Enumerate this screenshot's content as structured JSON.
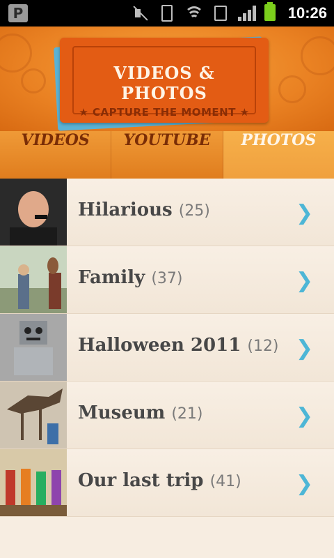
{
  "status_bar": {
    "app_icon_letter": "P",
    "time": "10:26",
    "icons": [
      "mute-icon",
      "vibrate-icon",
      "wifi-icon",
      "sim-icon",
      "signal-icon",
      "battery-icon"
    ]
  },
  "header": {
    "title": "VIDEOS & PHOTOS",
    "subtitle": "★ CAPTURE THE MOMENT ★"
  },
  "tabs": [
    {
      "label": "VIDEOS"
    },
    {
      "label": "YOUTUBE"
    },
    {
      "label": "PHOTOS",
      "active": true
    }
  ],
  "albums": [
    {
      "name": "Hilarious",
      "count": "(25)"
    },
    {
      "name": "Family",
      "count": "(37)"
    },
    {
      "name": "Halloween 2011",
      "count": "(12)"
    },
    {
      "name": "Museum",
      "count": "(21)"
    },
    {
      "name": "Our last trip",
      "count": "(41)"
    }
  ],
  "chevron": "❯",
  "colors": {
    "accent": "#e35c14",
    "chevron": "#4db6d6",
    "tab_active": "#f0a03e"
  }
}
